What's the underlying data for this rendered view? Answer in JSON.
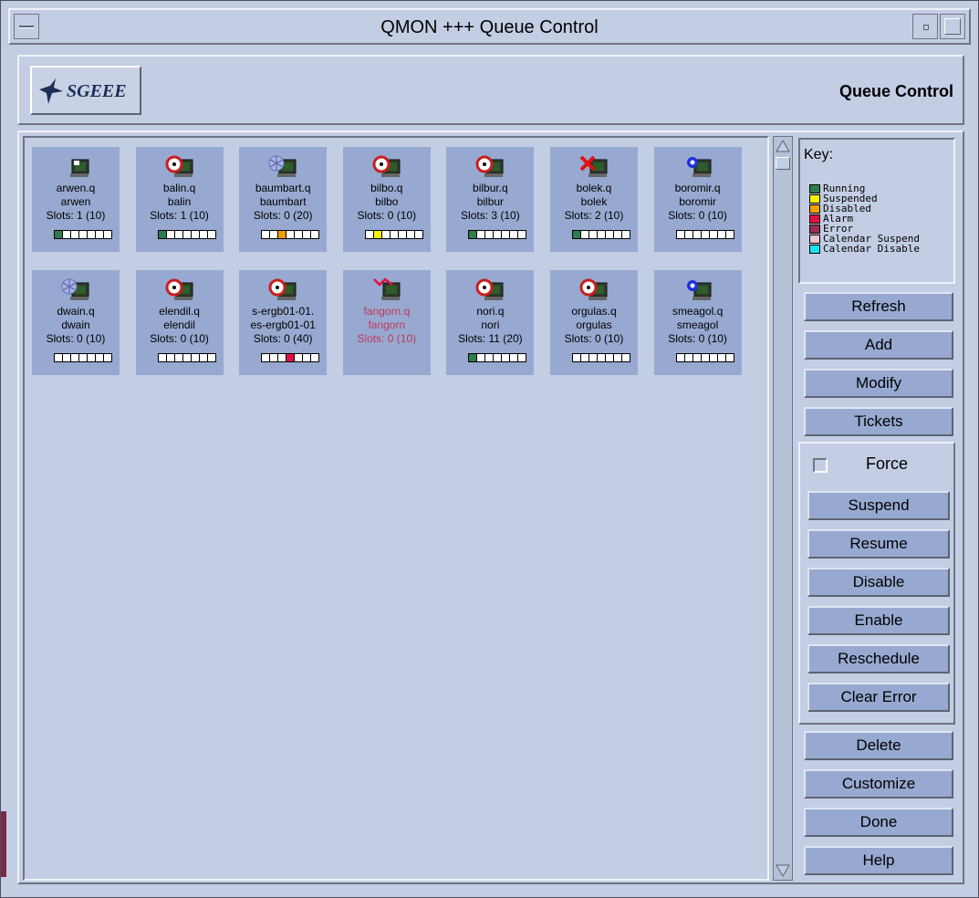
{
  "window": {
    "title": "QMON +++ Queue Control"
  },
  "header": {
    "logo_text": "SGEEE",
    "title": "Queue Control"
  },
  "queues": [
    {
      "name": "arwen.q",
      "host": "arwen",
      "slots_text": "Slots: 1 (10)",
      "icon": "terminal-icon",
      "state": "normal",
      "slot_colors": [
        "#2e7d4f",
        "#fff",
        "#fff",
        "#fff",
        "#fff",
        "#fff",
        "#fff"
      ]
    },
    {
      "name": "balin.q",
      "host": "balin",
      "slots_text": "Slots: 1 (10)",
      "icon": "load-clock-icon",
      "state": "normal",
      "slot_colors": [
        "#2e7d4f",
        "#fff",
        "#fff",
        "#fff",
        "#fff",
        "#fff",
        "#fff"
      ]
    },
    {
      "name": "baumbart.q",
      "host": "baumbart",
      "slots_text": "Slots: 0 (20)",
      "icon": "snowflake-icon",
      "state": "normal",
      "slot_colors": [
        "#fff",
        "#fff",
        "#f0a000",
        "#fff",
        "#fff",
        "#fff",
        "#fff"
      ]
    },
    {
      "name": "bilbo.q",
      "host": "bilbo",
      "slots_text": "Slots: 0 (10)",
      "icon": "load-clock-icon",
      "state": "normal",
      "slot_colors": [
        "#fff",
        "#f5f000",
        "#fff",
        "#fff",
        "#fff",
        "#fff",
        "#fff"
      ]
    },
    {
      "name": "bilbur.q",
      "host": "bilbur",
      "slots_text": "Slots: 3 (10)",
      "icon": "load-clock-icon",
      "state": "normal",
      "slot_colors": [
        "#2e7d4f",
        "#fff",
        "#fff",
        "#fff",
        "#fff",
        "#fff",
        "#fff"
      ]
    },
    {
      "name": "bolek.q",
      "host": "bolek",
      "slots_text": "Slots: 2 (10)",
      "icon": "error-x-icon",
      "state": "normal",
      "slot_colors": [
        "#2e7d4f",
        "#fff",
        "#fff",
        "#fff",
        "#fff",
        "#fff",
        "#fff"
      ]
    },
    {
      "name": "boromir.q",
      "host": "boromir",
      "slots_text": "Slots: 0 (10)",
      "icon": "blue-badge-icon",
      "state": "normal",
      "slot_colors": [
        "#fff",
        "#fff",
        "#fff",
        "#fff",
        "#fff",
        "#fff",
        "#fff"
      ]
    },
    {
      "name": "dwain.q",
      "host": "dwain",
      "slots_text": "Slots: 0 (10)",
      "icon": "snowflake-icon",
      "state": "normal",
      "slot_colors": [
        "#fff",
        "#fff",
        "#fff",
        "#fff",
        "#fff",
        "#fff",
        "#fff"
      ]
    },
    {
      "name": "elendil.q",
      "host": "elendil",
      "slots_text": "Slots: 0 (10)",
      "icon": "load-clock-icon",
      "state": "normal",
      "slot_colors": [
        "#fff",
        "#fff",
        "#fff",
        "#fff",
        "#fff",
        "#fff",
        "#fff"
      ]
    },
    {
      "name": "s-ergb01-01.",
      "host": "es-ergb01-01",
      "slots_text": "Slots: 0 (40)",
      "icon": "load-clock-icon",
      "state": "normal",
      "slot_colors": [
        "#fff",
        "#fff",
        "#fff",
        "#e01040",
        "#fff",
        "#fff",
        "#fff"
      ]
    },
    {
      "name": "fangorn.q",
      "host": "fangorn",
      "slots_text": "Slots: 0 (10)",
      "icon": "alarm-icon",
      "state": "alarm",
      "slot_colors": []
    },
    {
      "name": "nori.q",
      "host": "nori",
      "slots_text": "Slots: 11 (20)",
      "icon": "load-clock-icon",
      "state": "normal",
      "slot_colors": [
        "#2e7d4f",
        "#fff",
        "#fff",
        "#fff",
        "#fff",
        "#fff",
        "#fff"
      ]
    },
    {
      "name": "orgulas.q",
      "host": "orgulas",
      "slots_text": "Slots: 0 (10)",
      "icon": "load-clock-icon",
      "state": "normal",
      "slot_colors": [
        "#fff",
        "#fff",
        "#fff",
        "#fff",
        "#fff",
        "#fff",
        "#fff"
      ]
    },
    {
      "name": "smeagol.q",
      "host": "smeagol",
      "slots_text": "Slots: 0 (10)",
      "icon": "blue-badge-icon",
      "state": "normal",
      "slot_colors": [
        "#fff",
        "#fff",
        "#fff",
        "#fff",
        "#fff",
        "#fff",
        "#fff"
      ]
    }
  ],
  "key": {
    "title": "Key:",
    "items": [
      {
        "label": "Running",
        "color": "#2e7d4f"
      },
      {
        "label": "Suspended",
        "color": "#f5f000"
      },
      {
        "label": "Disabled",
        "color": "#f0a000"
      },
      {
        "label": "Alarm",
        "color": "#e01040"
      },
      {
        "label": "Error",
        "color": "#9b2c56"
      },
      {
        "label": "Calendar Suspend",
        "color": "#f2c6cf"
      },
      {
        "label": "Calendar Disable",
        "color": "#19e3f0"
      }
    ]
  },
  "buttons": {
    "refresh": "Refresh",
    "add": "Add",
    "modify": "Modify",
    "tickets": "Tickets",
    "force": "Force",
    "suspend": "Suspend",
    "resume": "Resume",
    "disable": "Disable",
    "enable": "Enable",
    "reschedule": "Reschedule",
    "clear_error": "Clear Error",
    "delete": "Delete",
    "customize": "Customize",
    "done": "Done",
    "help": "Help"
  }
}
